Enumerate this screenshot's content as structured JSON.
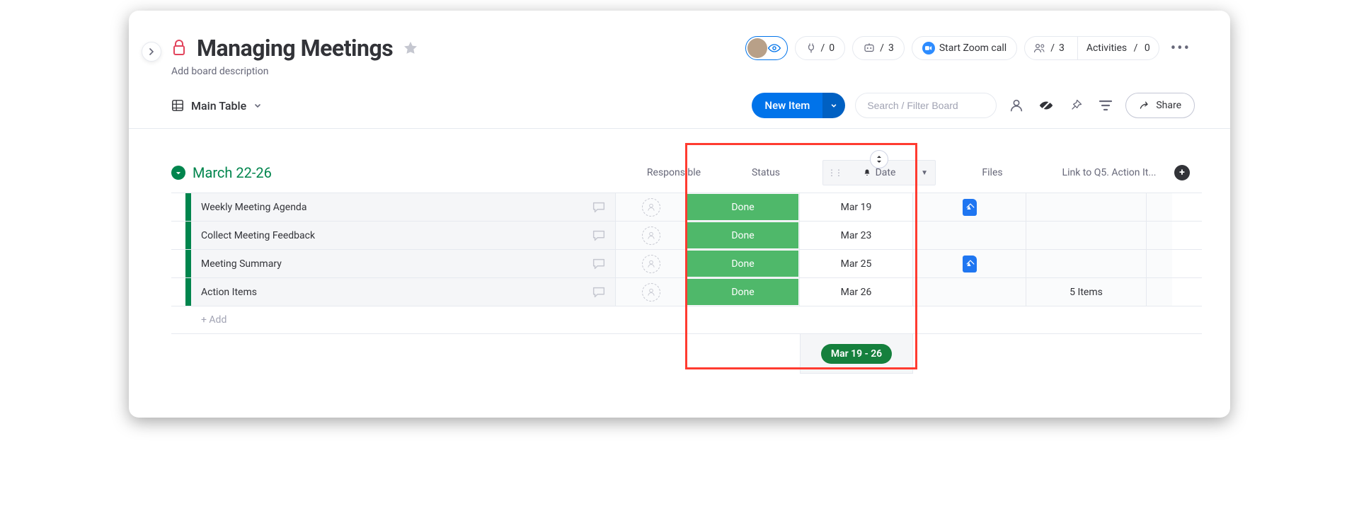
{
  "board": {
    "title": "Managing Meetings",
    "description_placeholder": "Add board description"
  },
  "header_widgets": {
    "integrations": {
      "count": "0"
    },
    "automations": {
      "count": "3"
    },
    "zoom_label": "Start Zoom call",
    "members": {
      "count": "3"
    },
    "activities": {
      "label": "Activities",
      "count": "0"
    }
  },
  "toolbar": {
    "view_label": "Main Table",
    "new_item_label": "New Item",
    "search_placeholder": "Search / Filter Board",
    "share_label": "Share"
  },
  "group": {
    "title": "March 22-26",
    "columns": {
      "responsible": "Responsible",
      "status": "Status",
      "date": "Date",
      "files": "Files",
      "link": "Link to Q5. Action It..."
    },
    "rows": [
      {
        "name": "Weekly Meeting Agenda",
        "status": "Done",
        "date": "Mar 19",
        "has_file": true,
        "link": ""
      },
      {
        "name": "Collect Meeting Feedback",
        "status": "Done",
        "date": "Mar 23",
        "has_file": false,
        "link": ""
      },
      {
        "name": "Meeting Summary",
        "status": "Done",
        "date": "Mar 25",
        "has_file": true,
        "link": ""
      },
      {
        "name": "Action Items",
        "status": "Done",
        "date": "Mar 26",
        "has_file": false,
        "link": "5 Items"
      }
    ],
    "add_row_label": "+ Add",
    "date_summary": "Mar 19 - 26"
  },
  "colors": {
    "accent_green": "#00854d",
    "status_green": "#4fb86a",
    "highlight_red": "#ff3b30",
    "primary_blue": "#0073ea"
  }
}
